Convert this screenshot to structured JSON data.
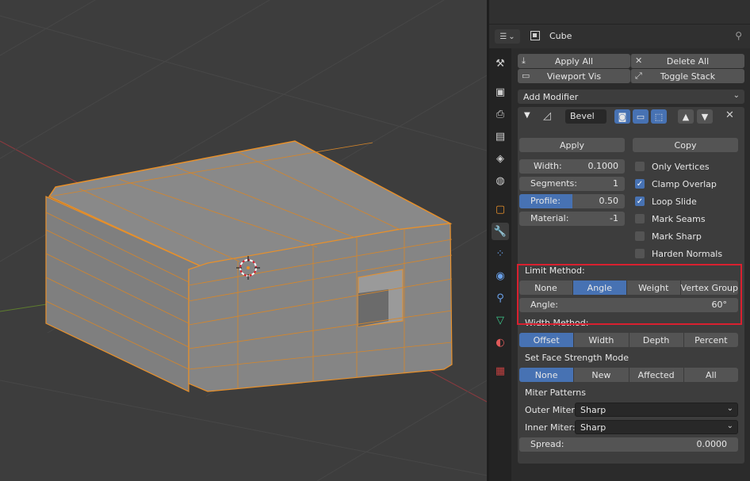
{
  "header": {
    "object_name": "Cube",
    "editor_icon": "properties-editor-icon",
    "pin_icon": "pin-icon"
  },
  "stack": {
    "apply_all": "Apply All",
    "delete_all": "Delete All",
    "viewport_vis": "Viewport Vis",
    "toggle_stack": "Toggle Stack"
  },
  "add_modifier": "Add Modifier",
  "modifier": {
    "name": "Bevel",
    "apply_label": "Apply",
    "copy_label": "Copy",
    "width_label": "Width:",
    "width_value": "0.1000",
    "segments_label": "Segments:",
    "segments_value": "1",
    "profile_label": "Profile:",
    "profile_value": "0.50",
    "profile_fraction": 0.5,
    "material_label": "Material:",
    "material_value": "-1",
    "checks": [
      {
        "label": "Only Vertices",
        "checked": false
      },
      {
        "label": "Clamp Overlap",
        "checked": true
      },
      {
        "label": "Loop Slide",
        "checked": true
      },
      {
        "label": "Mark Seams",
        "checked": false
      },
      {
        "label": "Mark Sharp",
        "checked": false
      },
      {
        "label": "Harden Normals",
        "checked": false
      }
    ],
    "limit_method_label": "Limit Method:",
    "limit_methods": [
      "None",
      "Angle",
      "Weight",
      "Vertex Group"
    ],
    "limit_selected": "Angle",
    "angle_label": "Angle:",
    "angle_value": "60°",
    "width_method_label": "Width Method:",
    "width_methods": [
      "Offset",
      "Width",
      "Depth",
      "Percent"
    ],
    "width_method_selected": "Offset",
    "face_strength_label": "Set Face Strength Mode",
    "face_strength_modes": [
      "None",
      "New",
      "Affected",
      "All"
    ],
    "face_strength_selected": "None",
    "miter_patterns_label": "Miter Patterns",
    "outer_miter_label": "Outer Miter:",
    "outer_miter_value": "Sharp",
    "inner_miter_label": "Inner Miter:",
    "inner_miter_value": "Sharp",
    "spread_label": "Spread:",
    "spread_value": "0.0000"
  },
  "colors": {
    "accent": "#4772b3",
    "highlight": "#d9202f",
    "selection": "#e8902a"
  }
}
